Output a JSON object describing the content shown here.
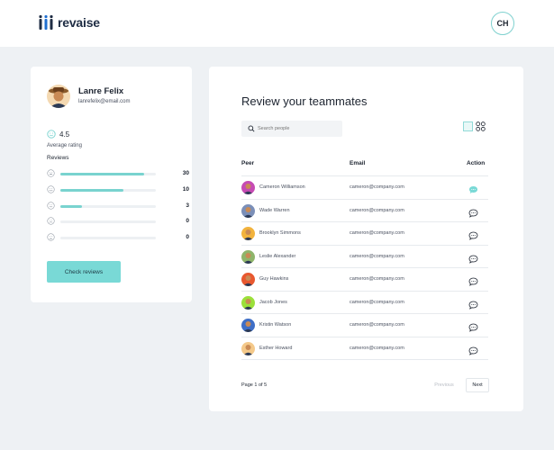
{
  "brand": {
    "name": "revaise",
    "accent": "#79d9d6"
  },
  "user_menu": {
    "initials": "CH"
  },
  "profile": {
    "name": "Lanre Felix",
    "email": "lanrefelix@email.com",
    "rating": "4.5",
    "rating_label": "Average rating",
    "reviews_title": "Reviews",
    "reviews": [
      {
        "icon": "very-happy-face-icon",
        "fraction": 0.88,
        "count": "30"
      },
      {
        "icon": "happy-face-icon",
        "fraction": 0.66,
        "count": "10"
      },
      {
        "icon": "neutral-face-icon",
        "fraction": 0.23,
        "count": "3"
      },
      {
        "icon": "sad-face-icon",
        "fraction": 0.0,
        "count": "0"
      },
      {
        "icon": "very-sad-face-icon",
        "fraction": 0.0,
        "count": "0"
      }
    ],
    "check_button": "Check reviews"
  },
  "review": {
    "title": "Review your teammates",
    "search_placeholder": "Search people",
    "columns": {
      "peer": "Peer",
      "email": "Email",
      "action": "Action"
    },
    "rows": [
      {
        "name": "Cameron Williamson",
        "email": "cameron@company.com",
        "avatar_color": "#c64bb3",
        "active": true
      },
      {
        "name": "Wade Warren",
        "email": "cameron@company.com",
        "avatar_color": "#7b8fb8",
        "active": false
      },
      {
        "name": "Brooklyn Simmons",
        "email": "cameron@company.com",
        "avatar_color": "#f2b33d",
        "active": false
      },
      {
        "name": "Leslie Alexander",
        "email": "cameron@company.com",
        "avatar_color": "#8fb56b",
        "active": false
      },
      {
        "name": "Guy Hawkins",
        "email": "cameron@company.com",
        "avatar_color": "#e8582f",
        "active": false
      },
      {
        "name": "Jacob Jones",
        "email": "cameron@company.com",
        "avatar_color": "#9be03a",
        "active": false
      },
      {
        "name": "Kristin Watson",
        "email": "cameron@company.com",
        "avatar_color": "#3f6fc7",
        "active": false
      },
      {
        "name": "Esther Howard",
        "email": "cameron@company.com",
        "avatar_color": "#f4c98a",
        "active": false
      }
    ],
    "pager": {
      "text": "Page 1 of 5",
      "previous": "Previous",
      "next": "Next"
    }
  }
}
